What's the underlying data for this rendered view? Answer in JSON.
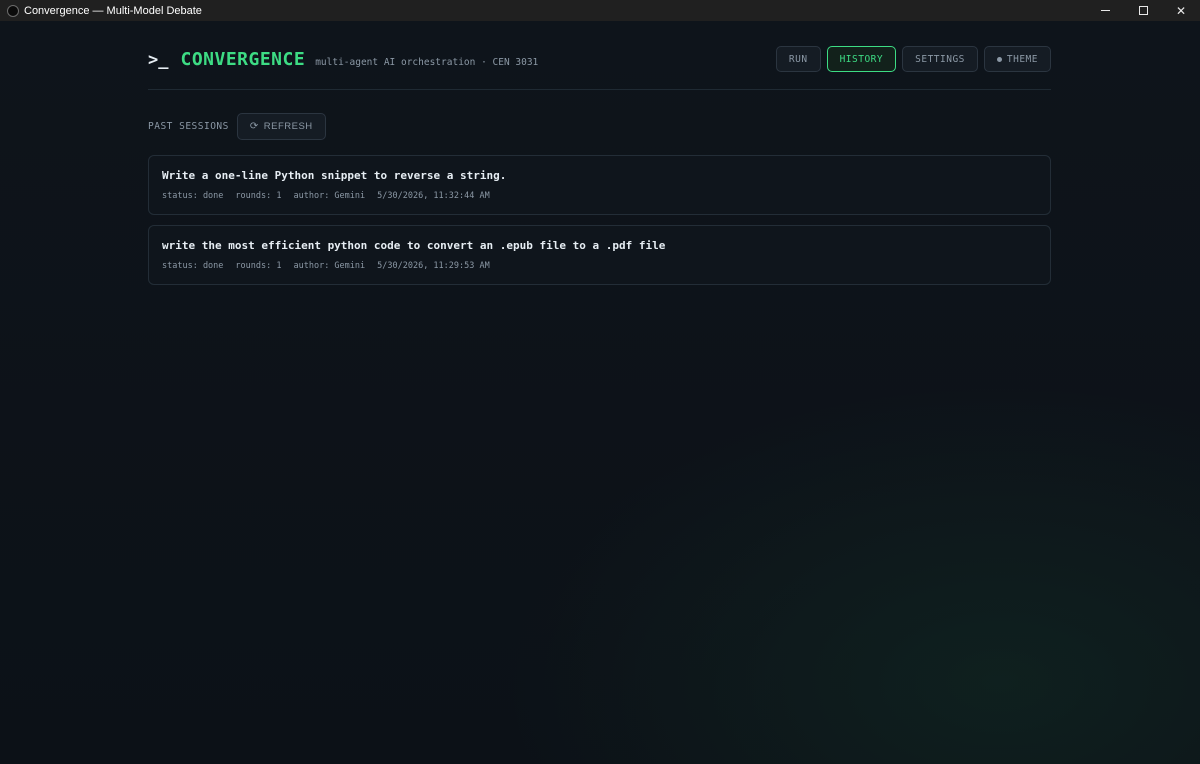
{
  "window": {
    "title": "Convergence — Multi-Model Debate"
  },
  "header": {
    "prompt_glyph": ">_",
    "brand": "CONVERGENCE",
    "subtitle": "multi-agent AI orchestration · CEN 3031",
    "nav": [
      {
        "label": "RUN",
        "active": false
      },
      {
        "label": "HISTORY",
        "active": true
      },
      {
        "label": "SETTINGS",
        "active": false
      },
      {
        "label": "THEME",
        "active": false,
        "icon": "circle-dot-icon"
      }
    ]
  },
  "history": {
    "section_label": "PAST SESSIONS",
    "refresh_label": "REFRESH",
    "refresh_icon": "refresh-icon",
    "sessions": [
      {
        "title": "Write a one-line Python snippet to reverse a string.",
        "status": "status: done",
        "rounds": "rounds: 1",
        "author": "author: Gemini",
        "timestamp": "5/30/2026, 11:32:44 AM"
      },
      {
        "title": "write the most efficient python code to convert an .epub file to a .pdf file",
        "status": "status: done",
        "rounds": "rounds: 1",
        "author": "author: Gemini",
        "timestamp": "5/30/2026, 11:29:53 AM"
      }
    ]
  },
  "colors": {
    "accent": "#3ddc84",
    "background": "#0d1117",
    "muted_text": "#8b98a5"
  }
}
